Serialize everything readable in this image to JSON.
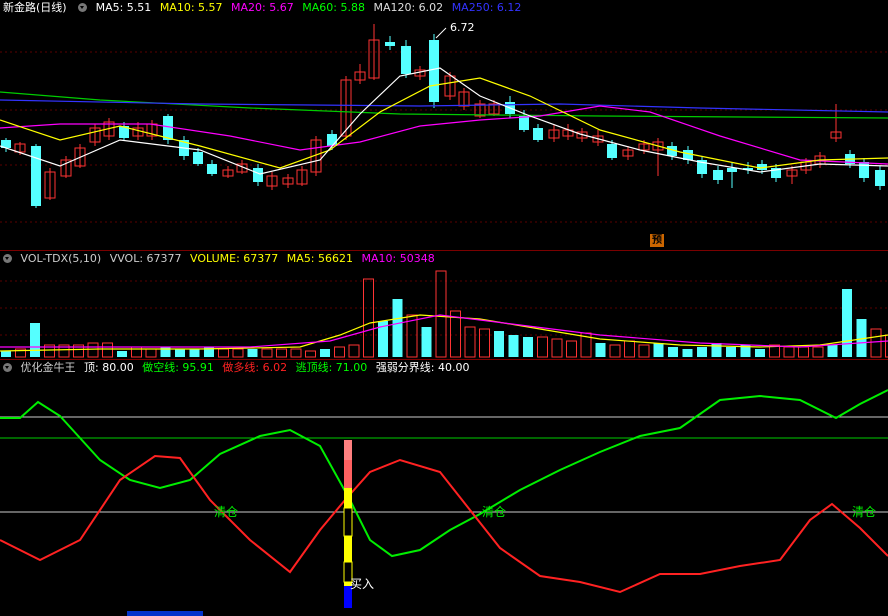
{
  "main": {
    "name": "新金路(日线)",
    "indicators": [
      {
        "label": "MA5: 5.51",
        "color": "#ffffff"
      },
      {
        "label": "MA10: 5.57",
        "color": "#ffff00"
      },
      {
        "label": "MA20: 5.67",
        "color": "#ff00ff"
      },
      {
        "label": "MA60: 5.88",
        "color": "#00ff00"
      },
      {
        "label": "MA120: 6.02",
        "color": "#dddddd"
      },
      {
        "label": "MA250: 6.12",
        "color": "#3333ff"
      }
    ],
    "high_label": "6.72",
    "predict_label": "预"
  },
  "volume": {
    "name": "VOL-TDX(5,10)",
    "indicators": [
      {
        "label": "VVOL: 67377",
        "color": "#cccccc"
      },
      {
        "label": "VOLUME: 67377",
        "color": "#ffff00"
      },
      {
        "label": "MA5: 56621",
        "color": "#ffff00"
      },
      {
        "label": "MA10: 50348",
        "color": "#ff00ff"
      }
    ]
  },
  "osc": {
    "name": "优化金牛王",
    "indicators": [
      {
        "label": "顶: 80.00",
        "color": "#ffffff"
      },
      {
        "label": "做空线: 95.91",
        "color": "#00ff00"
      },
      {
        "label": "做多线: 6.02",
        "color": "#ff2222"
      },
      {
        "label": "逃顶线: 71.00",
        "color": "#00ff00"
      },
      {
        "label": "强弱分界线: 40.00",
        "color": "#ffffff"
      }
    ],
    "clear_label": "清仓",
    "buy_label": "买入"
  }
}
